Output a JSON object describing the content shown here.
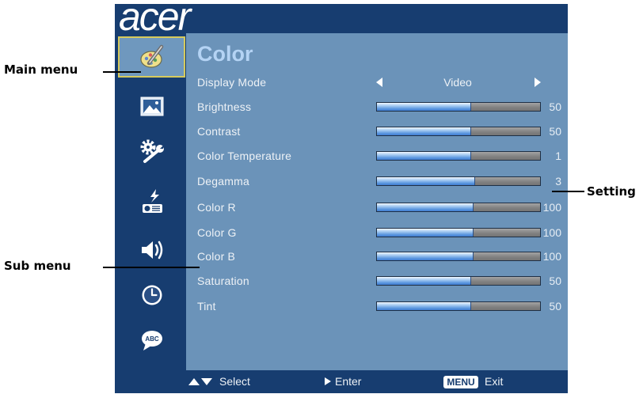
{
  "header": {
    "logo": "acer"
  },
  "callouts": {
    "main_menu": "Main menu",
    "sub_menu": "Sub menu",
    "setting": "Setting"
  },
  "sidebar": {
    "items": [
      {
        "icon": "color-icon",
        "selected": true
      },
      {
        "icon": "image-icon",
        "selected": false
      },
      {
        "icon": "settings-icon",
        "selected": false
      },
      {
        "icon": "management-icon",
        "selected": false
      },
      {
        "icon": "audio-icon",
        "selected": false
      },
      {
        "icon": "timer-icon",
        "selected": false
      },
      {
        "icon": "language-icon",
        "selected": false,
        "glyph": "ABC"
      }
    ]
  },
  "panel": {
    "title": "Color",
    "display_mode": {
      "label": "Display Mode",
      "value": "Video",
      "prev_icon": "left-triangle-icon",
      "next_icon": "right-triangle-icon"
    },
    "rows": [
      {
        "label": "Brightness",
        "value": "50",
        "level": 0.58
      },
      {
        "label": "Contrast",
        "value": "50",
        "level": 0.58
      },
      {
        "label": "Color Temperature",
        "value": "1",
        "level": 0.58
      },
      {
        "label": "Degamma",
        "value": "3",
        "level": 0.6
      },
      {
        "label": "Color R",
        "value": "100",
        "level": 0.59
      },
      {
        "label": "Color G",
        "value": "100",
        "level": 0.59
      },
      {
        "label": "Color B",
        "value": "100",
        "level": 0.59
      },
      {
        "label": "Saturation",
        "value": "50",
        "level": 0.58
      },
      {
        "label": "Tint",
        "value": "50",
        "level": 0.58
      }
    ]
  },
  "footer": {
    "select_icon": "up-down-arrows-icon",
    "select": "Select",
    "enter_icon": "right-triangle-icon",
    "enter": "Enter",
    "menu_key": "MENU",
    "exit": "Exit"
  },
  "colors": {
    "navy": "#173d70",
    "content": "#6b93b9",
    "title": "#b4d3f4",
    "selection_border": "#d6ca5c",
    "slider_fill": "#5b97df",
    "slider_empty": "#808080"
  }
}
